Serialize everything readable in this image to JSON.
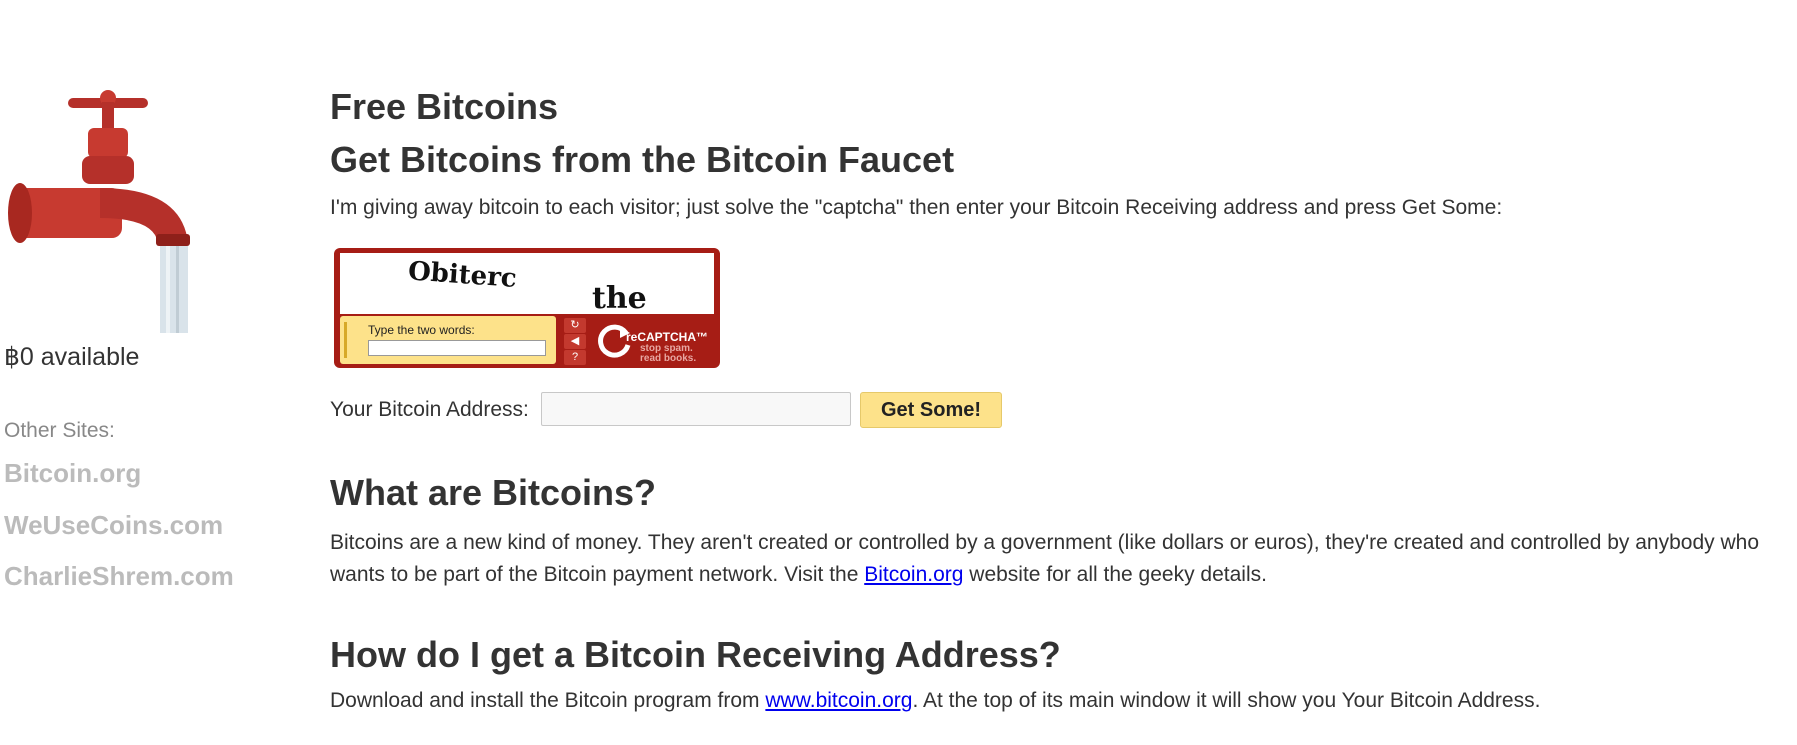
{
  "sidebar": {
    "faucet_image_alt": "faucet-icon",
    "available": "฿0 available",
    "other_sites_label": "Other Sites:",
    "sites": [
      "Bitcoin.org",
      "WeUseCoins.com",
      "CharlieShrem.com"
    ]
  },
  "main": {
    "title": "Free Bitcoins",
    "subtitle": "Get Bitcoins from the Bitcoin Faucet",
    "intro": "I'm giving away bitcoin to each visitor; just solve the \"captcha\" then enter your Bitcoin Receiving address and press Get Some:",
    "captcha": {
      "word1": "Obiterc",
      "word2": "the",
      "entry_label": "Type the two words:",
      "logo_text": "reCAPTCHA™",
      "tagline_1": "stop spam.",
      "tagline_2": "read books.",
      "buttons": [
        "↻",
        "◀",
        "?"
      ]
    },
    "address_label": "Your Bitcoin Address:",
    "address_value": "",
    "get_button": "Get Some!",
    "what_heading": "What are Bitcoins?",
    "what_text_1": "Bitcoins are a new kind of money. They aren't created or controlled by a government (like dollars or euros), they're created and controlled by anybody who wants to be part of the Bitcoin payment network. Visit the ",
    "what_link": "Bitcoin.org",
    "what_text_2": " website for all the geeky details.",
    "how_heading": "How do I get a Bitcoin Receiving Address?",
    "how_text_1": "Download and install the Bitcoin program from ",
    "how_link": "www.bitcoin.org",
    "how_text_2": ". At the top of its main window it will show you Your Bitcoin Address."
  },
  "colors": {
    "text": "#333333",
    "sidebar_link": "#bbbbbb",
    "button_bg": "#fde28a",
    "captcha_red": "#a61d15",
    "link": "#0000ee"
  }
}
